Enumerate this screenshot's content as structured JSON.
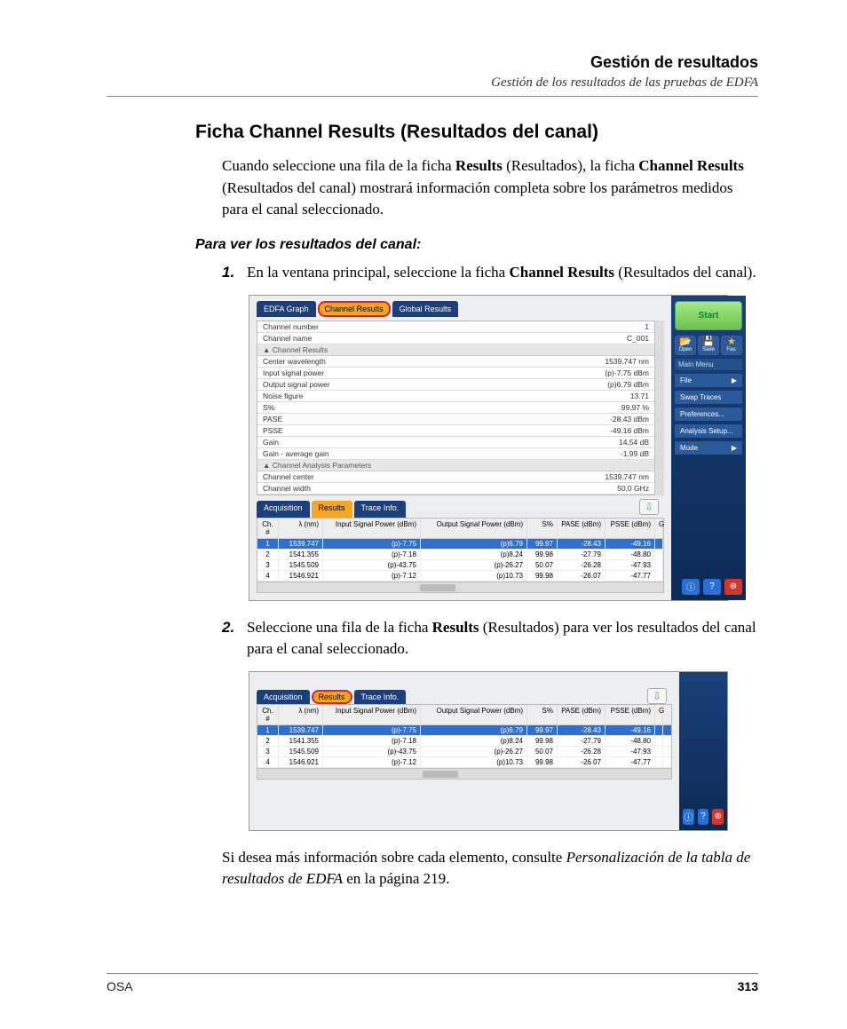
{
  "header": {
    "title": "Gestión de resultados",
    "subtitle": "Gestión de los resultados de las pruebas de EDFA"
  },
  "section": {
    "heading": "Ficha Channel Results (Resultados del canal)"
  },
  "intro": {
    "p1a": "Cuando seleccione una fila de la ficha ",
    "p1b": "Results",
    "p1c": " (Resultados), la ficha ",
    "p1d": "Channel Results",
    "p1e": " (Resultados del canal) mostrará información completa sobre los parámetros medidos para el canal seleccionado."
  },
  "sub": {
    "heading": "Para ver los resultados del canal:"
  },
  "steps": {
    "n1": "1.",
    "s1a": "En la ventana principal, seleccione la ficha ",
    "s1b": "Channel Results",
    "s1c": " (Resultados del canal).",
    "n2": "2.",
    "s2a": "Seleccione una fila de la ficha ",
    "s2b": "Results",
    "s2c": " (Resultados) para ver los resultados del canal para el canal seleccionado."
  },
  "closing": {
    "a": "Si desea más información sobre cada elemento, consulte ",
    "b": "Personalización de la tabla de resultados de EDFA",
    "c": " en la página 219."
  },
  "footer": {
    "left": "OSA",
    "right": "313"
  },
  "app": {
    "tabs": {
      "edfa": "EDFA Graph",
      "chres": "Channel Results",
      "glob": "Global Results"
    },
    "subtabs": {
      "acq": "Acquisition",
      "res": "Results",
      "trace": "Trace Info."
    },
    "props": {
      "g0": "▲  Channel Results",
      "g1": "▲  Channel Analysis Parameters",
      "r0l": "Channel number",
      "r0v": "1",
      "r1l": "Channel name",
      "r1v": "C_001",
      "r2l": "Center wavelength",
      "r2v": "1539.747 nm",
      "r3l": "Input signal power",
      "r3v": "(p)-7.75 dBm",
      "r4l": "Output signal power",
      "r4v": "(p)6.79 dBm",
      "r5l": "Noise figure",
      "r5v": "13.71",
      "r6l": "S%",
      "r6v": "99.97 %",
      "r7l": "PASE",
      "r7v": "-28.43 dBm",
      "r8l": "PSSE",
      "r8v": "-49.16 dBm",
      "r9l": "Gain",
      "r9v": "14.54 dB",
      "r10l": "Gain - average gain",
      "r10v": "-1.99 dB",
      "r11l": "Channel center",
      "r11v": "1539.747 nm",
      "r12l": "Channel width",
      "r12v": "50.0 GHz"
    },
    "cols": {
      "c0": "Ch. #",
      "c1": "λ (nm)",
      "c2": "Input Signal Power (dBm)",
      "c3": "Output Signal Power (dBm)",
      "c4": "S%",
      "c5": "PASE (dBm)",
      "c6": "PSSE (dBm)",
      "c7": "G"
    },
    "rows": [
      {
        "ch": "1",
        "wl": "1539.747",
        "in": "(p)-7.75",
        "out": "(p)6.79",
        "s": "99.97",
        "pase": "-28.43",
        "psse": "-49.16"
      },
      {
        "ch": "2",
        "wl": "1541.355",
        "in": "(p)-7.18",
        "out": "(p)8.24",
        "s": "99.98",
        "pase": "-27.79",
        "psse": "-48.80"
      },
      {
        "ch": "3",
        "wl": "1545.509",
        "in": "(p)-43.75",
        "out": "(p)-26.27",
        "s": "50.07",
        "pase": "-26.28",
        "psse": "-47.93"
      },
      {
        "ch": "4",
        "wl": "1546.921",
        "in": "(p)-7.12",
        "out": "(p)10.73",
        "s": "99.98",
        "pase": "-26.07",
        "psse": "-47.77"
      }
    ],
    "side": {
      "start": "Start",
      "open": "Open",
      "save": "Save",
      "fav": "Fav.",
      "mainmenu": "Main Menu",
      "file": "File",
      "swap": "Swap Traces",
      "pref": "Preferences...",
      "setup": "Analysis Setup...",
      "mode": "Mode",
      "arrow": "▶"
    },
    "glyphs": {
      "folder": "📂",
      "disk": "💾",
      "star": "★",
      "down": "⇩",
      "info": "ⓘ",
      "help": "?",
      "close": "⊗"
    }
  }
}
